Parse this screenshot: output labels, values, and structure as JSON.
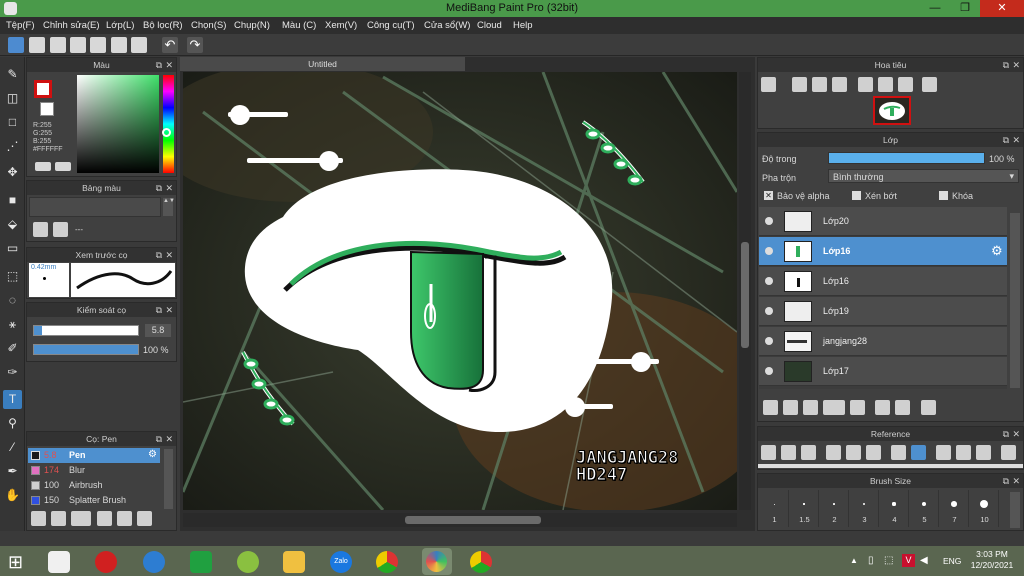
{
  "window": {
    "title": "MediBang Paint Pro (32bit)",
    "minimize": "—",
    "maximize": "❐",
    "close": "✕"
  },
  "menu": [
    "Tệp(F)",
    "Chỉnh sửa(E)",
    "Lớp(L)",
    "Bộ lọc(R)",
    "Chọn(S)",
    "Chụp(N)",
    "Màu (C)",
    "Xem(V)",
    "Công cụ(T)",
    "Cửa sổ(W)",
    "Cloud",
    "Help"
  ],
  "color_panel": {
    "title": "Màu",
    "rgb_r": "R:255",
    "rgb_g": "G:255",
    "rgb_b": "B:255",
    "hex": "#FFFFFF"
  },
  "swatch_panel": {
    "title": "Bảng màu",
    "dash": "---"
  },
  "brush_preview": {
    "title": "Xem trước cọ",
    "size": "0.42mm"
  },
  "brush_control": {
    "title": "Kiểm soát cọ",
    "size_value": "5.8",
    "opacity_value": "100 %",
    "opacity_fraction": 1.0
  },
  "brush_list": {
    "title": "Cọ: Pen",
    "items": [
      {
        "size": "5.8",
        "name": "Pen",
        "swatch": "#1a1a1a"
      },
      {
        "size": "174",
        "name": "Blur",
        "swatch": "#e070c0"
      },
      {
        "size": "100",
        "name": "Airbrush",
        "swatch": "#d0d0d0"
      },
      {
        "size": "150",
        "name": "Splatter Brush",
        "swatch": "#3050e0"
      }
    ]
  },
  "canvas": {
    "tab_title": "Untitled",
    "watermark_line1": "JANGJANG28",
    "watermark_line2": "HD247"
  },
  "navigator": {
    "title": "Hoa tiêu"
  },
  "layer_panel": {
    "title": "Lớp",
    "opacity_label": "Độ trong",
    "opacity_value": "100 %",
    "blend_label": "Pha trộn",
    "blend_value": "Bình thường",
    "protect_alpha": "Bảo vệ alpha",
    "clipping": "Xén bớt",
    "lock": "Khóa",
    "layers": [
      {
        "name": "Lớp20",
        "selected": false
      },
      {
        "name": "Lớp16",
        "selected": true
      },
      {
        "name": "Lớp16",
        "selected": false
      },
      {
        "name": "Lớp19",
        "selected": false
      },
      {
        "name": "jangjang28",
        "selected": false
      },
      {
        "name": "Lớp17",
        "selected": false
      }
    ]
  },
  "reference_panel": {
    "title": "Reference"
  },
  "brush_size_panel": {
    "title": "Brush Size",
    "sizes": [
      "1",
      "1.5",
      "2",
      "3",
      "4",
      "5",
      "7",
      "10"
    ]
  },
  "taskbar": {
    "language": "ENG",
    "time": "3:03 PM",
    "date": "12/20/2021",
    "zalo": "Zalo"
  },
  "colors": {
    "accent": "#4e90cf",
    "titlebar": "#4a9a4a",
    "art_green": "#2fae5c"
  }
}
